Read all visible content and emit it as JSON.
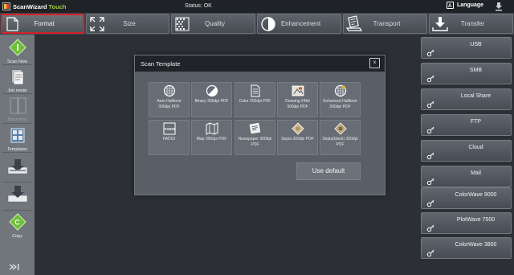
{
  "app": {
    "name_main": "ScanWizard",
    "name_accent": "Touch"
  },
  "status": "Status: OK",
  "language": "Language",
  "tabs": [
    {
      "label": "Format",
      "icon": "document-icon",
      "active": true
    },
    {
      "label": "Size",
      "icon": "resize-icon",
      "active": false
    },
    {
      "label": "Quality",
      "icon": "quality-grid-icon",
      "active": false
    },
    {
      "label": "Enhancement",
      "icon": "contrast-icon",
      "active": false
    },
    {
      "label": "Transport",
      "icon": "transport-icon",
      "active": false
    },
    {
      "label": "Transfer",
      "icon": "download-tray-icon",
      "active": false
    }
  ],
  "leftbar": [
    {
      "label": "Scan Now",
      "icon": "scan-now-icon",
      "enabled": true
    },
    {
      "label": "Job mode",
      "icon": "job-mode-icon",
      "enabled": true
    },
    {
      "label": "Mastering",
      "icon": "mastering-icon",
      "enabled": false
    },
    {
      "label": "Templates",
      "icon": "templates-icon",
      "enabled": true
    },
    {
      "label": "",
      "icon": "scan-to-tray-icon",
      "enabled": true
    },
    {
      "label": "",
      "icon": "download-icon",
      "enabled": true
    },
    {
      "label": "Copy",
      "icon": "copy-icon",
      "enabled": true
    }
  ],
  "dialog": {
    "title": "Scan Template",
    "close_label": "x",
    "use_default": "Use default",
    "templates": [
      {
        "line1": "Auto Halftone",
        "line2": "300dpi PDF",
        "icon": "auto-halftone-icon"
      },
      {
        "line1": "Binary 300dpi PDF",
        "line2": "",
        "icon": "binary-icon"
      },
      {
        "line1": "Color 200dpi PDF",
        "line2": "",
        "icon": "color-doc-icon"
      },
      {
        "line1": "Drawing 24bit",
        "line2": "300dpi PDF",
        "icon": "drawing-icon"
      },
      {
        "line1": "Enhanced Halftone",
        "line2": "300dpi PDF",
        "icon": "enhanced-halftone-icon"
      },
      {
        "line1": "FADGI",
        "line2": "",
        "icon": "fadgi-icon"
      },
      {
        "line1": "Map 300dpi PDF",
        "line2": "",
        "icon": "map-icon"
      },
      {
        "line1": "Newspaper 300dpi",
        "line2": "PDF",
        "icon": "newspaper-icon"
      },
      {
        "line1": "Sepia 300dpi PDF",
        "line2": "",
        "icon": "sepia-icon"
      },
      {
        "line1": "Sepia(black) 300dpi",
        "line2": "PDF",
        "icon": "sepia-black-icon"
      }
    ]
  },
  "destinations": [
    {
      "label": "USB"
    },
    {
      "label": "SMB"
    },
    {
      "label": "Local Share"
    },
    {
      "label": "FTP"
    },
    {
      "label": "Cloud"
    },
    {
      "label": "Mail"
    },
    {
      "label": "ColorWave 9000"
    },
    {
      "label": "PlotWave 7500"
    },
    {
      "label": "ColorWave 3800"
    }
  ],
  "colors": {
    "accent_green": "#9ccf3c",
    "active_border": "#d3242b"
  }
}
